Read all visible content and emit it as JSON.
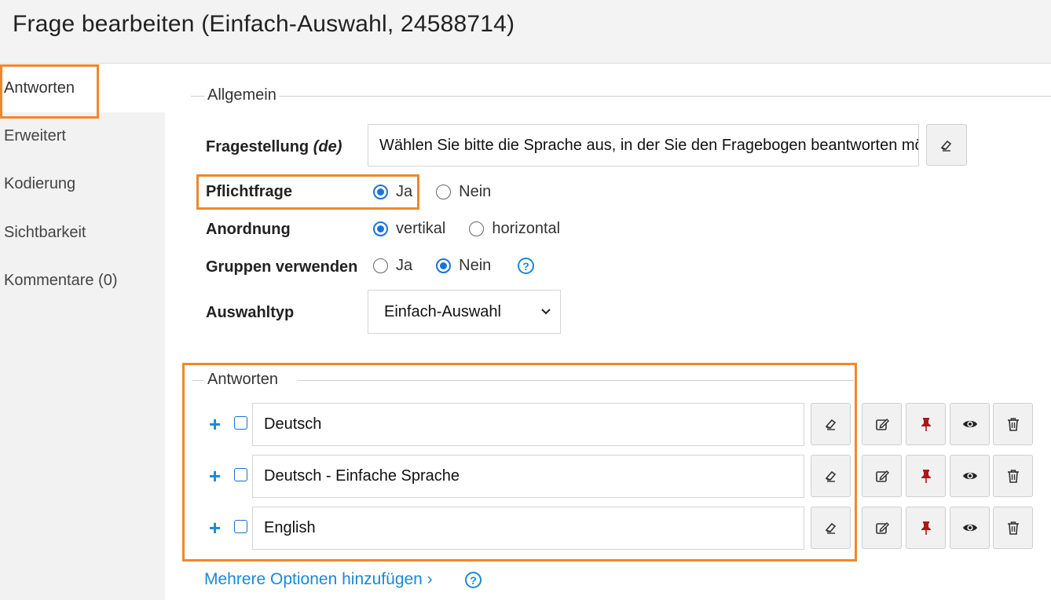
{
  "header": {
    "title": "Frage bearbeiten (Einfach-Auswahl, 24588714)"
  },
  "sidebar": {
    "items": [
      {
        "label": "Antworten",
        "active": true
      },
      {
        "label": "Erweitert"
      },
      {
        "label": "Kodierung"
      },
      {
        "label": "Sichtbarkeit"
      },
      {
        "label": "Kommentare (0)"
      }
    ]
  },
  "general": {
    "legend": "Allgemein",
    "question_label": "Fragestellung",
    "question_lang": "(de)",
    "question_value": "Wählen Sie bitte die Sprache aus, in der Sie den Fragebogen beantworten möchten.",
    "mandatory": {
      "label": "Pflichtfrage",
      "yes": "Ja",
      "no": "Nein",
      "selected": "yes"
    },
    "arrangement": {
      "label": "Anordnung",
      "vertical": "vertikal",
      "horizontal": "horizontal",
      "selected": "vertical"
    },
    "groups": {
      "label": "Gruppen verwenden",
      "yes": "Ja",
      "no": "Nein",
      "selected": "no",
      "help": "?"
    },
    "choice_type": {
      "label": "Auswahltyp",
      "value": "Einfach-Auswahl"
    }
  },
  "answers": {
    "legend": "Antworten",
    "items": [
      {
        "text": "Deutsch"
      },
      {
        "text": "Deutsch - Einfache Sprache"
      },
      {
        "text": "English"
      }
    ],
    "add_multiple": "Mehrere Optionen hinzufügen ›",
    "help": "?"
  },
  "colors": {
    "accent": "#1a88d8",
    "highlight": "#f0882a",
    "pin": "#b01515"
  }
}
